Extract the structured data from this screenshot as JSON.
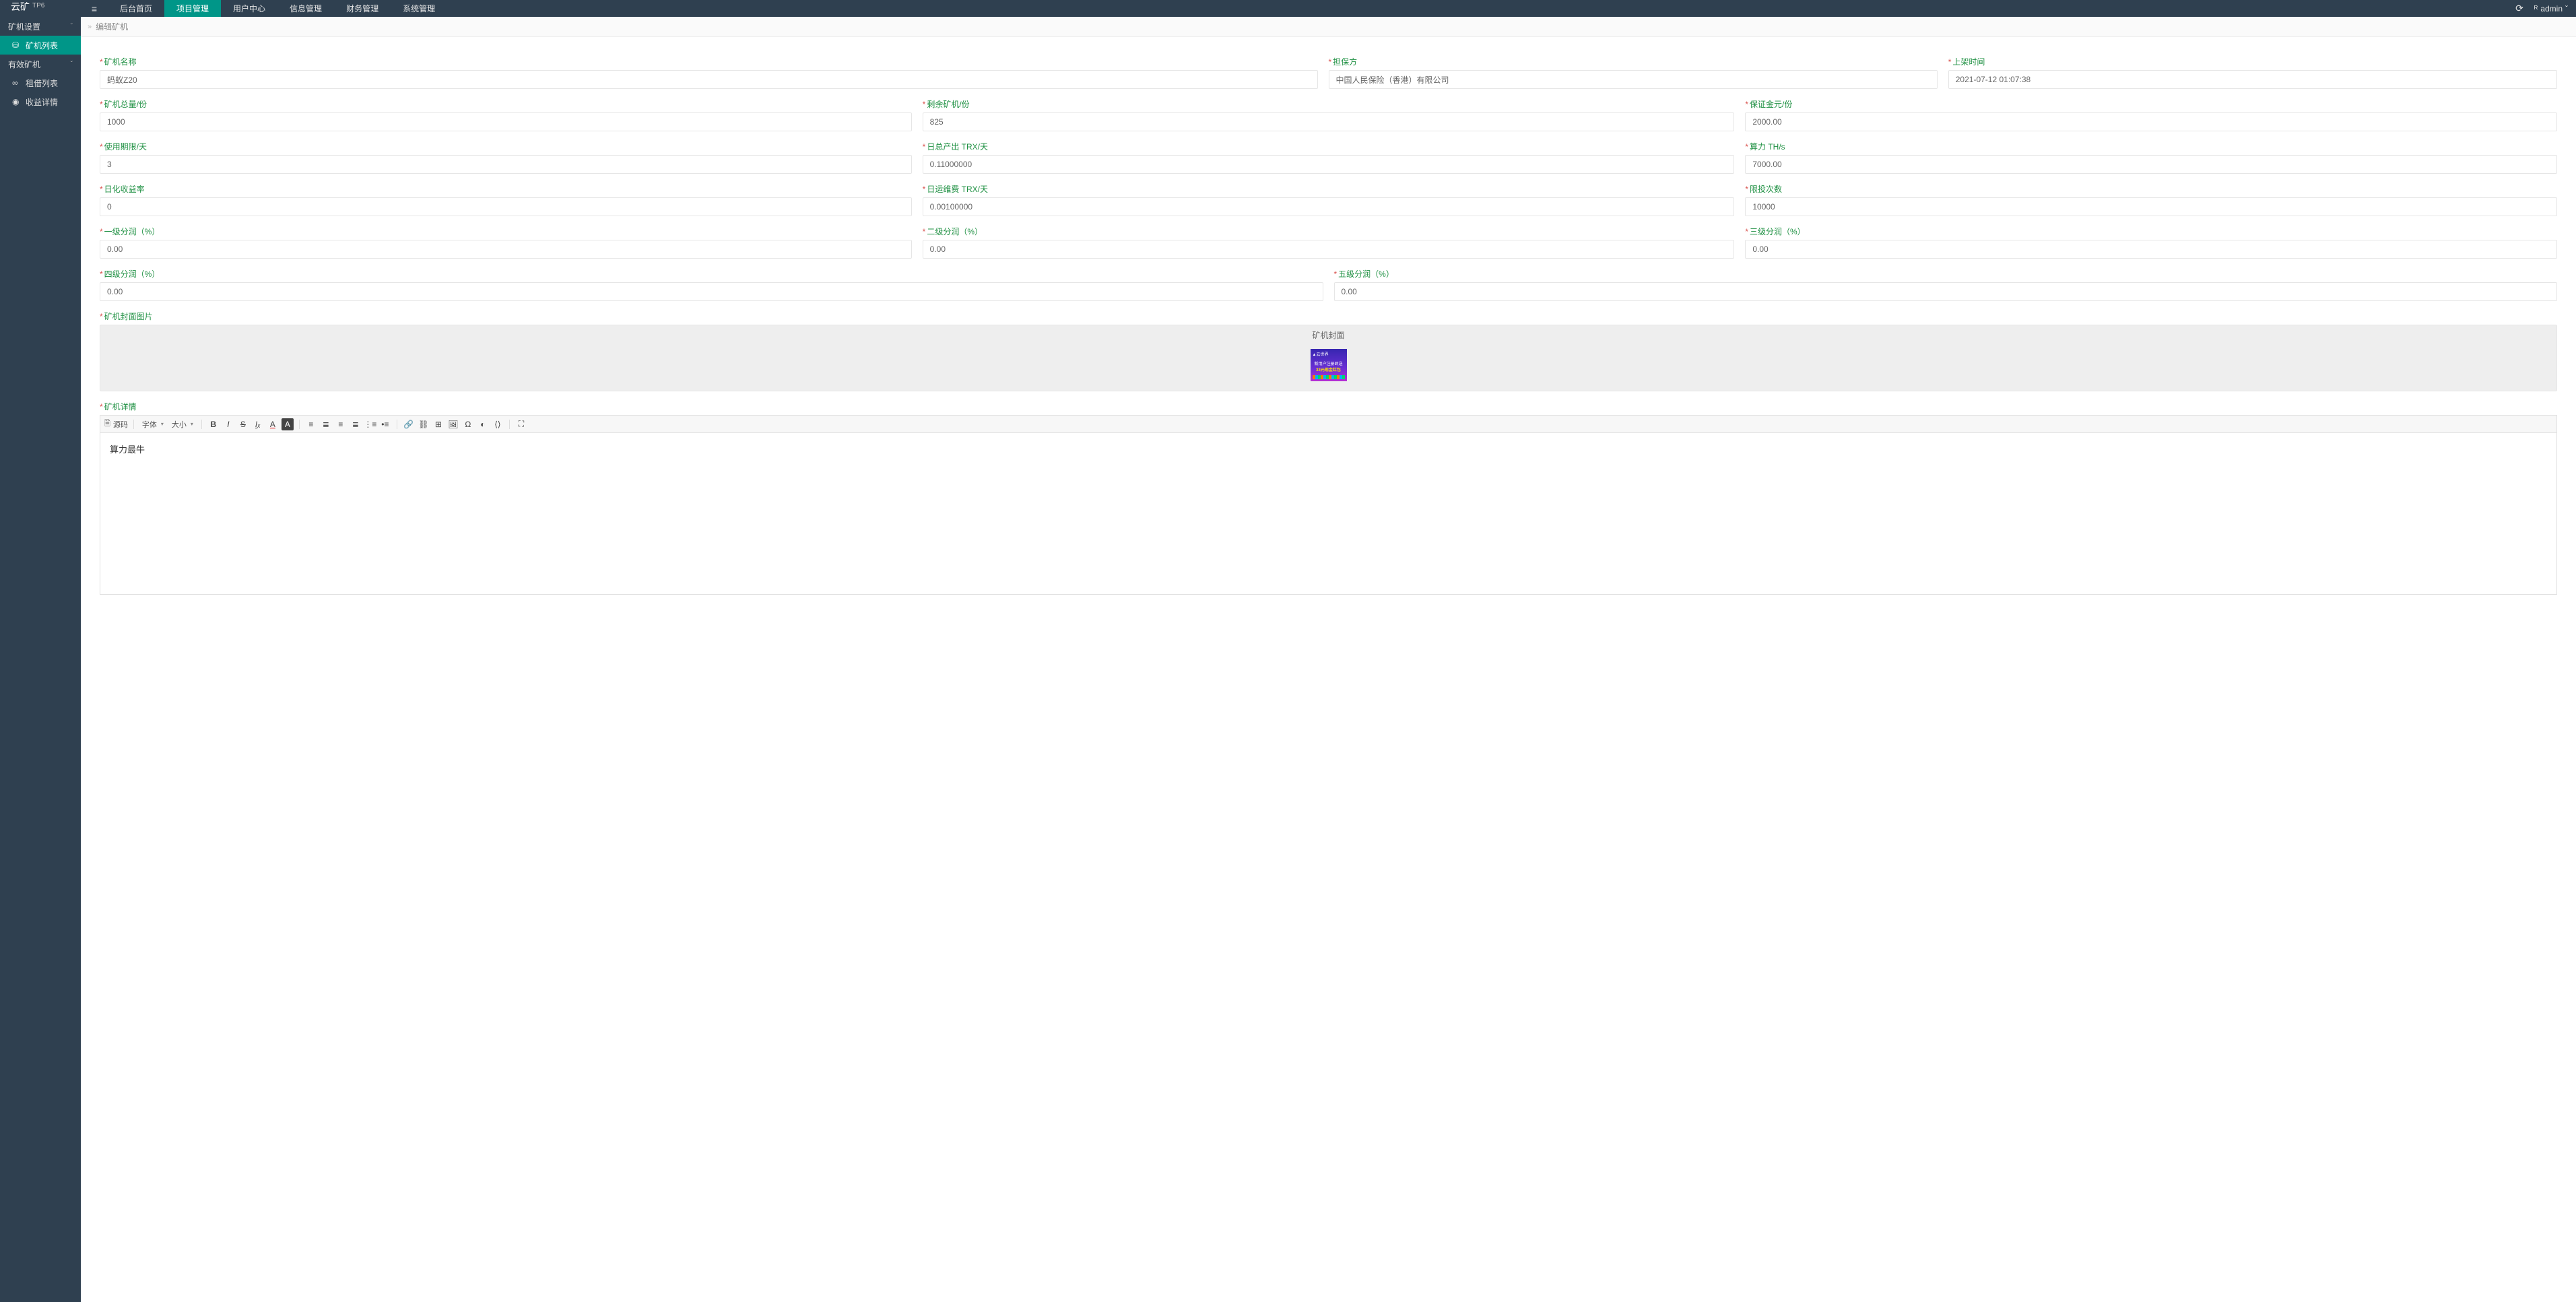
{
  "brand": {
    "main": "云矿",
    "sup": "TP6"
  },
  "nav": {
    "hamburger_icon": "≡",
    "tabs": [
      "后台首页",
      "项目管理",
      "用户中心",
      "信息管理",
      "财务管理",
      "系统管理"
    ],
    "active_index": 1
  },
  "header_right": {
    "refresh_icon": "⟳",
    "user_icon": "ᴿ",
    "username": "admin",
    "caret": "ˇ"
  },
  "sidebar": {
    "groups": [
      {
        "title": "矿机设置",
        "chev": "ˇ",
        "items": [
          {
            "icon": "⛁",
            "label": "矿机列表",
            "active": true
          }
        ]
      },
      {
        "title": "有效矿机",
        "chev": "ˇ",
        "items": [
          {
            "icon": "∞",
            "label": "租借列表",
            "active": false
          },
          {
            "icon": "◉",
            "label": "收益详情",
            "active": false
          }
        ]
      }
    ]
  },
  "breadcrumb": {
    "arrow": "»",
    "current": "编辑矿机"
  },
  "form": {
    "row1": [
      {
        "label": "矿机名称",
        "value": "蚂蚁Z20"
      },
      {
        "label": "担保方",
        "value": "中国人民保险（香港）有限公司"
      },
      {
        "label": "上架时间",
        "value": "2021-07-12 01:07:38"
      }
    ],
    "row2": [
      {
        "label": "矿机总量/份",
        "value": "1000"
      },
      {
        "label": "剩余矿机/份",
        "value": "825"
      },
      {
        "label": "保证金元/份",
        "value": "2000.00"
      }
    ],
    "row3": [
      {
        "label": "使用期限/天",
        "value": "3"
      },
      {
        "label": "日总产出 TRX/天",
        "value": "0.11000000"
      },
      {
        "label": "算力 TH/s",
        "value": "7000.00"
      }
    ],
    "row4": [
      {
        "label": "日化收益率",
        "value": "0"
      },
      {
        "label": "日运维费 TRX/天",
        "value": "0.00100000"
      },
      {
        "label": "限投次数",
        "value": "10000"
      }
    ],
    "row5": [
      {
        "label": "一级分润（%）",
        "value": "0.00"
      },
      {
        "label": "二级分润（%）",
        "value": "0.00"
      },
      {
        "label": "三级分润（%）",
        "value": "0.00"
      }
    ],
    "row6": [
      {
        "label": "四级分润（%）",
        "value": "0.00"
      },
      {
        "label": "五级分润（%）",
        "value": "0.00"
      }
    ],
    "cover": {
      "label": "矿机封面图片",
      "head": "矿机封面"
    },
    "thumb_lines": {
      "t1": "▲云世界",
      "t2": "新用户注册即送",
      "t3": "33元现金红包"
    },
    "detail_label": "矿机详情",
    "editor": {
      "source_icon": "🗎",
      "source_label": "源码",
      "font_family_label": "字体",
      "font_size_label": "大小",
      "content": "算力最牛"
    }
  }
}
